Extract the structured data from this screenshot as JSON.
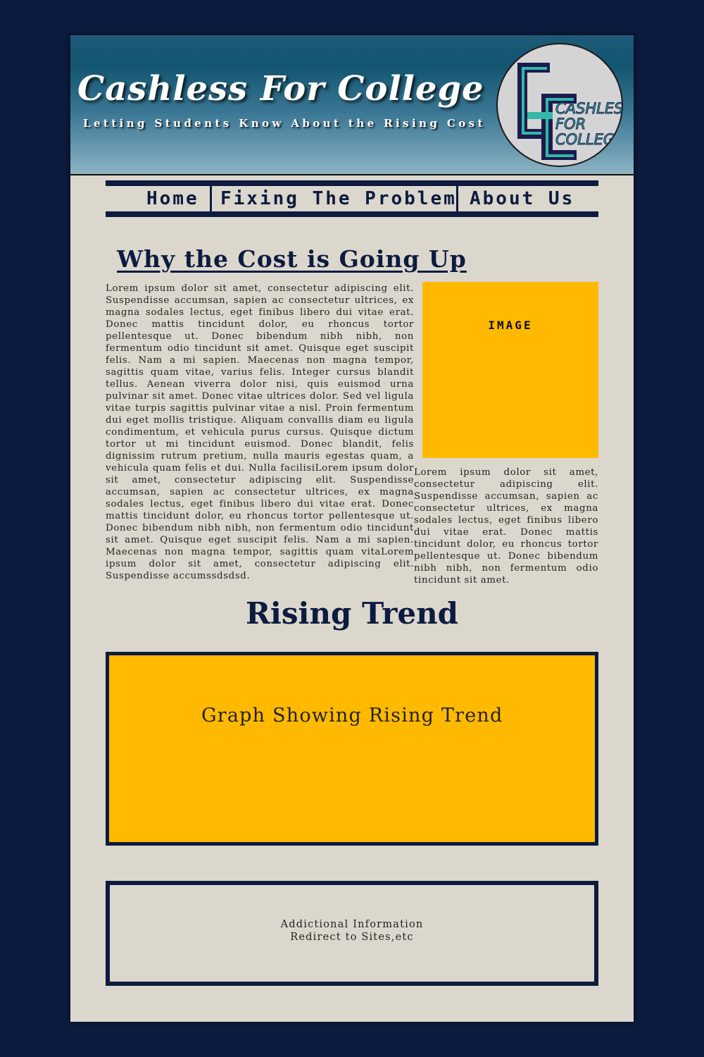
{
  "header": {
    "title": "Cashless For College",
    "tagline": "Letting Students Know About the Rising Cost",
    "logo": {
      "line1": "CASHLESS",
      "line2": "FOR",
      "line3": "COLLEGE",
      "colors": {
        "dark": "#1c1b4e",
        "teal": "#33b8a8",
        "bg": "#d4d4d4"
      }
    }
  },
  "nav": {
    "items": [
      {
        "label": "Home"
      },
      {
        "label": "Fixing The Problem"
      },
      {
        "label": "About Us"
      }
    ]
  },
  "main": {
    "section1": {
      "title": "Why the Cost is Going Up",
      "left_text": "Lorem ipsum dolor sit amet, consectetur adipiscing elit. Suspendisse accumsan, sapien ac consectetur ultrices, ex magna sodales lectus, eget finibus libero dui vitae erat. Donec mattis tincidunt dolor, eu rhoncus tortor pellentesque ut. Donec bibendum nibh nibh, non fermentum odio tincidunt sit amet. Quisque eget suscipit felis. Nam a mi sapien. Maecenas non magna tempor, sagittis quam vitae, varius felis. Integer cursus blandit tellus. Aenean viverra dolor nisi, quis euismod urna pulvinar sit amet. Donec vitae ultrices dolor. Sed vel ligula vitae turpis sagittis pulvinar vitae a nisl. Proin fermentum dui eget mollis tristique. Aliquam convallis diam eu ligula condimentum, et vehicula purus cursus. Quisque dictum tortor ut mi tincidunt euismod. Donec blandit, felis dignissim rutrum pretium, nulla mauris egestas quam, a vehicula quam felis et dui. Nulla facilisiLorem ipsum dolor sit amet, consectetur adipiscing elit. Suspendisse accumsan, sapien ac consectetur ultrices, ex magna sodales lectus, eget finibus libero dui vitae erat. Donec mattis tincidunt dolor, eu rhoncus tortor pellentesque ut. Donec bibendum nibh nibh, non fermentum odio tincidunt sit amet. Quisque eget suscipit felis. Nam a mi sapien. Maecenas non magna tempor, sagittis quam vitaLorem ipsum dolor sit amet, consectetur adipiscing elit. Suspendisse accumssdsdsd.",
      "image_label": "IMAGE",
      "right_text": "Lorem ipsum dolor sit amet, consectetur adipiscing elit. Suspendisse accumsan, sapien ac consectetur ultrices, ex magna sodales lectus, eget finibus libero dui vitae erat. Donec mattis tincidunt dolor, eu rhoncus tortor pellentesque ut. Donec bibendum nibh nibh, non fermentum odio tincidunt sit amet."
    },
    "section2": {
      "title": "Rising Trend",
      "graph_label": "Graph Showing Rising Trend"
    },
    "info": {
      "line1": "Addictional Information",
      "line2": "Redirect to Sites,etc"
    }
  },
  "colors": {
    "navy": "#0c1b3f",
    "gold": "#ffb900",
    "page": "#dcd7cd"
  }
}
